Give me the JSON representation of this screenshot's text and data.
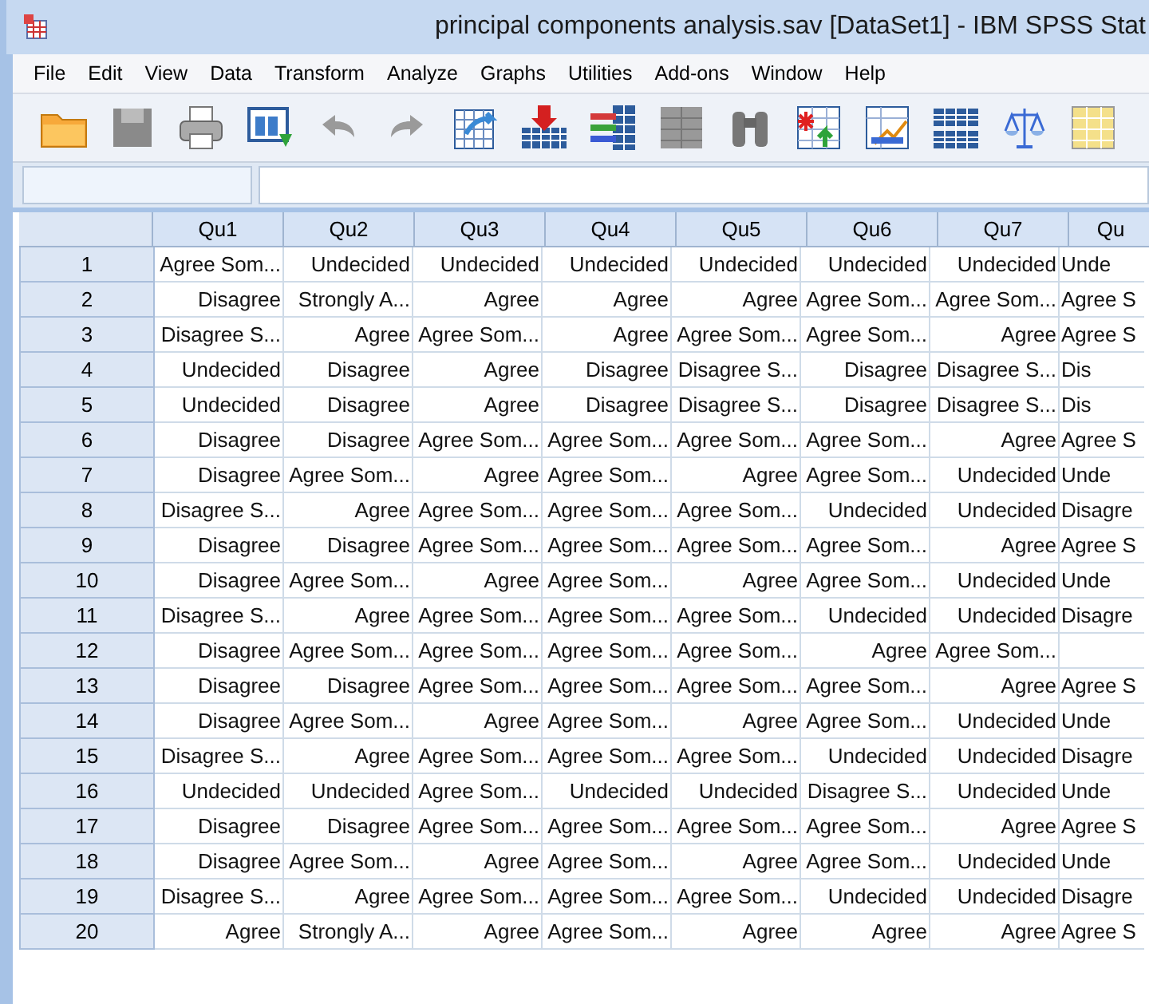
{
  "window": {
    "title": "principal components analysis.sav [DataSet1] - IBM SPSS Stat"
  },
  "menu": [
    "File",
    "Edit",
    "View",
    "Data",
    "Transform",
    "Analyze",
    "Graphs",
    "Utilities",
    "Add-ons",
    "Window",
    "Help"
  ],
  "grid": {
    "columns": [
      "Qu1",
      "Qu2",
      "Qu3",
      "Qu4",
      "Qu5",
      "Qu6",
      "Qu7",
      "Qu"
    ],
    "rows": [
      {
        "number": "1",
        "cells": [
          "Agree Som...",
          "Undecided",
          "Undecided",
          "Undecided",
          "Undecided",
          "Undecided",
          "Undecided",
          "Unde"
        ]
      },
      {
        "number": "2",
        "cells": [
          "Disagree",
          "Strongly A...",
          "Agree",
          "Agree",
          "Agree",
          "Agree Som...",
          "Agree Som...",
          "Agree S"
        ]
      },
      {
        "number": "3",
        "cells": [
          "Disagree S...",
          "Agree",
          "Agree Som...",
          "Agree",
          "Agree Som...",
          "Agree Som...",
          "Agree",
          "Agree S"
        ]
      },
      {
        "number": "4",
        "cells": [
          "Undecided",
          "Disagree",
          "Agree",
          "Disagree",
          "Disagree S...",
          "Disagree",
          "Disagree S...",
          "Dis"
        ]
      },
      {
        "number": "5",
        "cells": [
          "Undecided",
          "Disagree",
          "Agree",
          "Disagree",
          "Disagree S...",
          "Disagree",
          "Disagree S...",
          "Dis"
        ]
      },
      {
        "number": "6",
        "cells": [
          "Disagree",
          "Disagree",
          "Agree Som...",
          "Agree Som...",
          "Agree Som...",
          "Agree Som...",
          "Agree",
          "Agree S"
        ]
      },
      {
        "number": "7",
        "cells": [
          "Disagree",
          "Agree Som...",
          "Agree",
          "Agree Som...",
          "Agree",
          "Agree Som...",
          "Undecided",
          "Unde"
        ]
      },
      {
        "number": "8",
        "cells": [
          "Disagree S...",
          "Agree",
          "Agree Som...",
          "Agree Som...",
          "Agree Som...",
          "Undecided",
          "Undecided",
          "Disagre"
        ]
      },
      {
        "number": "9",
        "cells": [
          "Disagree",
          "Disagree",
          "Agree Som...",
          "Agree Som...",
          "Agree Som...",
          "Agree Som...",
          "Agree",
          "Agree S"
        ]
      },
      {
        "number": "10",
        "cells": [
          "Disagree",
          "Agree Som...",
          "Agree",
          "Agree Som...",
          "Agree",
          "Agree Som...",
          "Undecided",
          "Unde"
        ]
      },
      {
        "number": "11",
        "cells": [
          "Disagree S...",
          "Agree",
          "Agree Som...",
          "Agree Som...",
          "Agree Som...",
          "Undecided",
          "Undecided",
          "Disagre"
        ]
      },
      {
        "number": "12",
        "cells": [
          "Disagree",
          "Agree Som...",
          "Agree Som...",
          "Agree Som...",
          "Agree Som...",
          "Agree",
          "Agree Som..."
        ]
      },
      {
        "number": "13",
        "cells": [
          "Disagree",
          "Disagree",
          "Agree Som...",
          "Agree Som...",
          "Agree Som...",
          "Agree Som...",
          "Agree",
          "Agree S"
        ]
      },
      {
        "number": "14",
        "cells": [
          "Disagree",
          "Agree Som...",
          "Agree",
          "Agree Som...",
          "Agree",
          "Agree Som...",
          "Undecided",
          "Unde"
        ]
      },
      {
        "number": "15",
        "cells": [
          "Disagree S...",
          "Agree",
          "Agree Som...",
          "Agree Som...",
          "Agree Som...",
          "Undecided",
          "Undecided",
          "Disagre"
        ]
      },
      {
        "number": "16",
        "cells": [
          "Undecided",
          "Undecided",
          "Agree Som...",
          "Undecided",
          "Undecided",
          "Disagree S...",
          "Undecided",
          "Unde"
        ]
      },
      {
        "number": "17",
        "cells": [
          "Disagree",
          "Disagree",
          "Agree Som...",
          "Agree Som...",
          "Agree Som...",
          "Agree Som...",
          "Agree",
          "Agree S"
        ]
      },
      {
        "number": "18",
        "cells": [
          "Disagree",
          "Agree Som...",
          "Agree",
          "Agree Som...",
          "Agree",
          "Agree Som...",
          "Undecided",
          "Unde"
        ]
      },
      {
        "number": "19",
        "cells": [
          "Disagree S...",
          "Agree",
          "Agree Som...",
          "Agree Som...",
          "Agree Som...",
          "Undecided",
          "Undecided",
          "Disagre"
        ]
      },
      {
        "number": "20",
        "cells": [
          "Agree",
          "Strongly A...",
          "Agree",
          "Agree Som...",
          "Agree",
          "Agree",
          "Agree",
          "Agree S"
        ]
      }
    ]
  }
}
